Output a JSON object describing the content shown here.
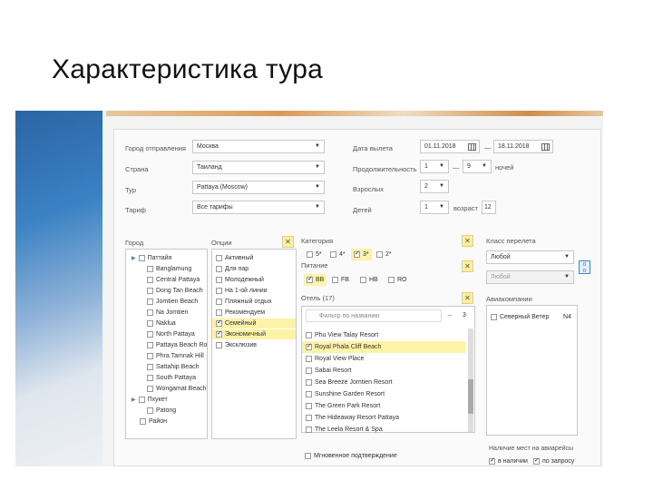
{
  "slide": {
    "title": "Характеристика тура"
  },
  "form": {
    "departure_city": {
      "label": "Город отправления",
      "value": "Москва"
    },
    "country": {
      "label": "Страна",
      "value": "Таиланд"
    },
    "tour": {
      "label": "Тур",
      "value": "Pattaya (Moscow)"
    },
    "tariff": {
      "label": "Тариф",
      "value": "Все тарифы"
    },
    "departure_date": {
      "label": "Дата вылета",
      "from": "01.11.2018",
      "dash": "—",
      "to": "18.11.2018"
    },
    "duration": {
      "label": "Продолжительность",
      "from": "1",
      "to": "9",
      "unit": "ночей"
    },
    "adults": {
      "label": "Взрослых",
      "value": "2"
    },
    "children": {
      "label": "Детей",
      "value": "1",
      "age_label": "возраст",
      "age": "12"
    }
  },
  "city_panel": {
    "label": "Город",
    "groups": [
      {
        "name": "Паттайя",
        "items": [
          "Banglamung",
          "Central Pattaya",
          "Dong Tan Beach",
          "Jomtien Beach",
          "Na Jomtien",
          "Naklua",
          "North Pattaya",
          "Pattaya Beach Ro",
          "Phra Tamnak Hill",
          "Sattahip Beach",
          "South Pattaya",
          "Wongamat Beach"
        ]
      },
      {
        "name": "Пхукет",
        "items": [
          "Patong"
        ]
      }
    ],
    "extra": "Район"
  },
  "options_panel": {
    "label": "Опции",
    "items": [
      {
        "text": "Активный",
        "checked": false
      },
      {
        "text": "Для пар",
        "checked": false
      },
      {
        "text": "Молодежный",
        "checked": false
      },
      {
        "text": "На 1-ой линии",
        "checked": false
      },
      {
        "text": "Пляжный отдых",
        "checked": false
      },
      {
        "text": "Рекомендуем",
        "checked": false
      },
      {
        "text": "Семейный",
        "checked": true
      },
      {
        "text": "Экономичный",
        "checked": true
      },
      {
        "text": "Эксклюзив",
        "checked": false
      }
    ],
    "clear": "✕"
  },
  "category": {
    "label": "Категория",
    "items": [
      "5*",
      "4*",
      "3*",
      "2*"
    ],
    "clear": "✕"
  },
  "meal": {
    "label": "Питание",
    "items": [
      "BB",
      "FB",
      "HB",
      "RO"
    ],
    "clear": "✕"
  },
  "hotels": {
    "label": "Отель (17)",
    "filter_placeholder": "Фильтр по названию",
    "count": "3",
    "clear": "✕",
    "items": [
      {
        "text": "Phu View Talay Resort",
        "checked": false
      },
      {
        "text": "Royal Phala Cliff Beach",
        "checked": true
      },
      {
        "text": "Royal View Place",
        "checked": false
      },
      {
        "text": "Sabai Resort",
        "checked": false
      },
      {
        "text": "Sea Breeze Jomtien Resort",
        "checked": false
      },
      {
        "text": "Sunshine Garden Resort",
        "checked": false
      },
      {
        "text": "The Green Park Resort",
        "checked": false
      },
      {
        "text": "The Hideaway Resort Pattaya",
        "checked": false
      },
      {
        "text": "The Leela Resort & Spa",
        "checked": false
      }
    ],
    "instant": "Мгновенное подтверждение"
  },
  "flight": {
    "class_label": "Класс перелета",
    "class_value": "Любой",
    "second_value": "Любой",
    "airlines_label": "Авиакомпании",
    "airline": {
      "name": "Северный Ветер",
      "code": "N4"
    },
    "seats_label": "Наличие мест на авиарейсы",
    "seats_options": [
      "в наличии",
      "по запросу"
    ]
  }
}
